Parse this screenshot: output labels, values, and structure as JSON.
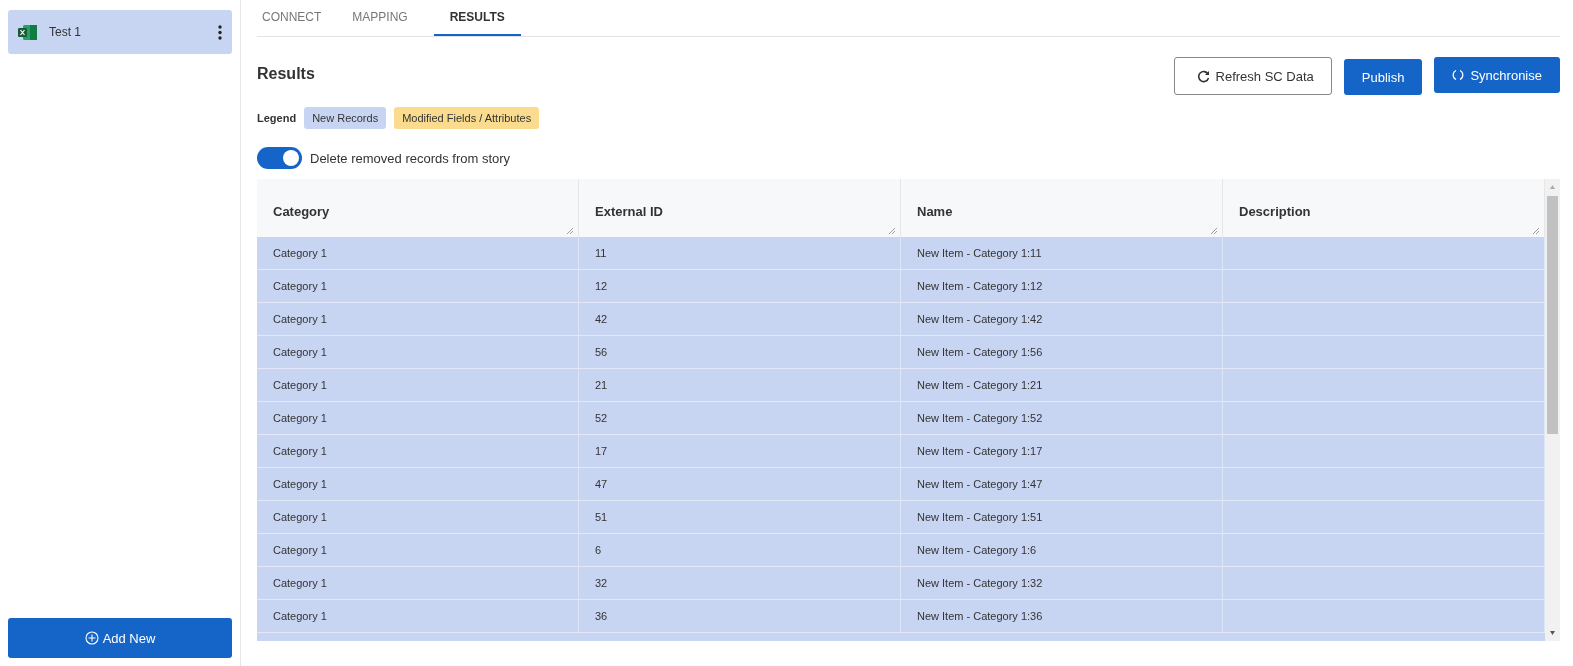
{
  "sidebar": {
    "items": [
      {
        "label": "Test 1",
        "selected": true
      }
    ],
    "add_button": "Add New"
  },
  "tabs": [
    {
      "label": "CONNECT",
      "selected": false
    },
    {
      "label": "MAPPING",
      "selected": false
    },
    {
      "label": "RESULTS",
      "selected": true
    }
  ],
  "title": "Results",
  "buttons": [
    {
      "label": "Refresh SC Data",
      "kind": "refresh"
    },
    {
      "label": "Publish",
      "kind": "primary"
    },
    {
      "label": "Synchronise",
      "kind": "sync"
    }
  ],
  "legend": {
    "label": "Legend",
    "items": [
      {
        "label": "New Records",
        "color": "#c8d5f2"
      },
      {
        "label": "Modified Fields / Attributes",
        "color": "#fbdc8e"
      }
    ]
  },
  "toggle": {
    "label": "Delete removed records from story",
    "on": true
  },
  "table": {
    "columns": [
      "Category",
      "External ID",
      "Name",
      "Description"
    ],
    "rows": [
      {
        "color": "#c8d5f2",
        "cells": [
          "Category 1",
          "11",
          "New Item - Category 1:11",
          ""
        ]
      },
      {
        "color": "#c8d5f2",
        "cells": [
          "Category 1",
          "12",
          "New Item - Category 1:12",
          ""
        ]
      },
      {
        "color": "#c8d5f2",
        "cells": [
          "Category 1",
          "42",
          "New Item - Category 1:42",
          ""
        ]
      },
      {
        "color": "#c8d5f2",
        "cells": [
          "Category 1",
          "56",
          "New Item - Category 1:56",
          ""
        ]
      },
      {
        "color": "#c8d5f2",
        "cells": [
          "Category 1",
          "21",
          "New Item - Category 1:21",
          ""
        ]
      },
      {
        "color": "#c8d5f2",
        "cells": [
          "Category 1",
          "52",
          "New Item - Category 1:52",
          ""
        ]
      },
      {
        "color": "#c8d5f2",
        "cells": [
          "Category 1",
          "17",
          "New Item - Category 1:17",
          ""
        ]
      },
      {
        "color": "#c8d5f2",
        "cells": [
          "Category 1",
          "47",
          "New Item - Category 1:47",
          ""
        ]
      },
      {
        "color": "#c8d5f2",
        "cells": [
          "Category 1",
          "51",
          "New Item - Category 1:51",
          ""
        ]
      },
      {
        "color": "#c8d5f2",
        "cells": [
          "Category 1",
          "6",
          "New Item - Category 1:6",
          ""
        ]
      },
      {
        "color": "#c8d5f2",
        "cells": [
          "Category 1",
          "32",
          "New Item - Category 1:32",
          ""
        ]
      },
      {
        "color": "#c8d5f2",
        "cells": [
          "Category 1",
          "36",
          "New Item - Category 1:36",
          ""
        ]
      }
    ]
  }
}
